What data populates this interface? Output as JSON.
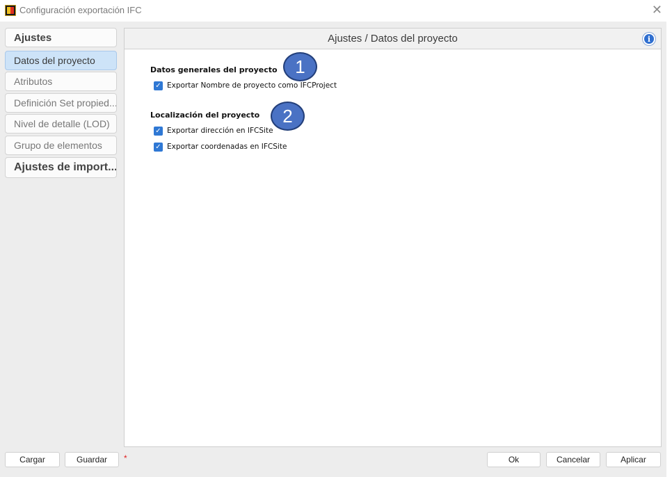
{
  "window": {
    "title": "Configuración exportación IFC",
    "close_glyph": "✕",
    "app_icon": "app-logo-icon"
  },
  "sidebar": {
    "items": [
      {
        "label": "Ajustes",
        "type": "header"
      },
      {
        "label": "Datos del proyecto",
        "type": "item",
        "selected": true
      },
      {
        "label": "Atributos",
        "type": "item"
      },
      {
        "label": "Definición Set propied...",
        "type": "item"
      },
      {
        "label": "Nivel de detalle (LOD)",
        "type": "item"
      },
      {
        "label": "Grupo de elementos",
        "type": "item"
      },
      {
        "label": "Ajustes de import...",
        "type": "header"
      }
    ]
  },
  "content": {
    "title": "Ajustes / Datos del proyecto",
    "info_glyph": "i",
    "sections": [
      {
        "title": "Datos generales del proyecto",
        "callout": "1",
        "options": [
          {
            "label": "Exportar Nombre de proyecto como IFCProject",
            "checked": true
          }
        ]
      },
      {
        "title": "Localización del proyecto",
        "callout": "2",
        "options": [
          {
            "label": "Exportar dirección en IFCSite",
            "checked": true
          },
          {
            "label": "Exportar coordenadas en IFCSite",
            "checked": true
          }
        ]
      }
    ]
  },
  "footer": {
    "load_label": "Cargar",
    "save_label": "Guardar",
    "modified_marker": "*",
    "ok_label": "Ok",
    "cancel_label": "Cancelar",
    "apply_label": "Aplicar"
  },
  "colors": {
    "selected_item_bg": "#cde3f8",
    "checkbox_accent": "#2f78d4",
    "callout_fill": "#4a72c4",
    "modified_marker": "#e02020"
  }
}
